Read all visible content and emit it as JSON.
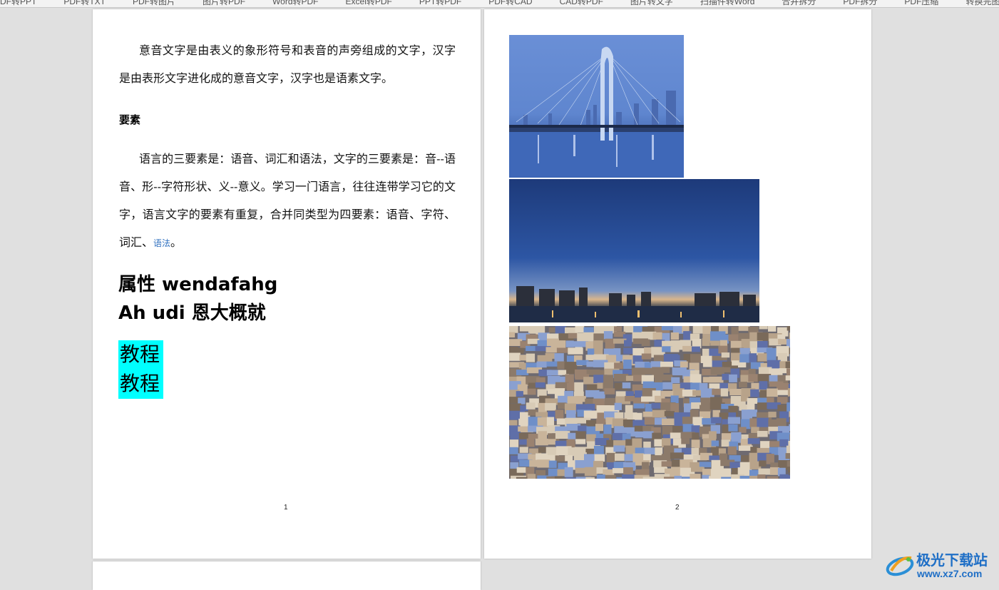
{
  "toolbar": {
    "items": [
      "DF转PPT",
      "PDF转TXT",
      "PDF转图片",
      "图片转PDF",
      "Word转PDF",
      "Excel转PDF",
      "PPT转PDF",
      "PDF转CAD",
      "CAD转PDF",
      "图片转文字",
      "扫描件转Word",
      "合并拆分",
      "PDF拆分",
      "PDF压缩",
      "转换完图"
    ]
  },
  "page1": {
    "para1": "意音文字是由表义的象形符号和表音的声旁组成的文字，汉字是由表形文字进化成的意音文字，汉字也是语素文字。",
    "heading": "要素",
    "para2": "语言的三要素是：语音、词汇和语法，文字的三要素是：音--语音、形--字符形状、义--意义。学习一门语言，往往连带学习它的文字，语言文字的要素有重复，合并同类型为四要素：语音、字符、词汇、",
    "para2_link": "语法",
    "para2_end": "。",
    "big_heading_1": "属性 wendafahg",
    "big_heading_2": "Ah udi 恩大概就",
    "highlight_1": "教程",
    "highlight_2": "教程",
    "page_number": "1"
  },
  "page2": {
    "page_number": "2"
  },
  "watermark": {
    "title": "极光下载站",
    "url": "www.xz7.com"
  },
  "colors": {
    "highlight": "#00ffff",
    "link": "#2e6fbf",
    "watermark": "#1f6fc6"
  }
}
